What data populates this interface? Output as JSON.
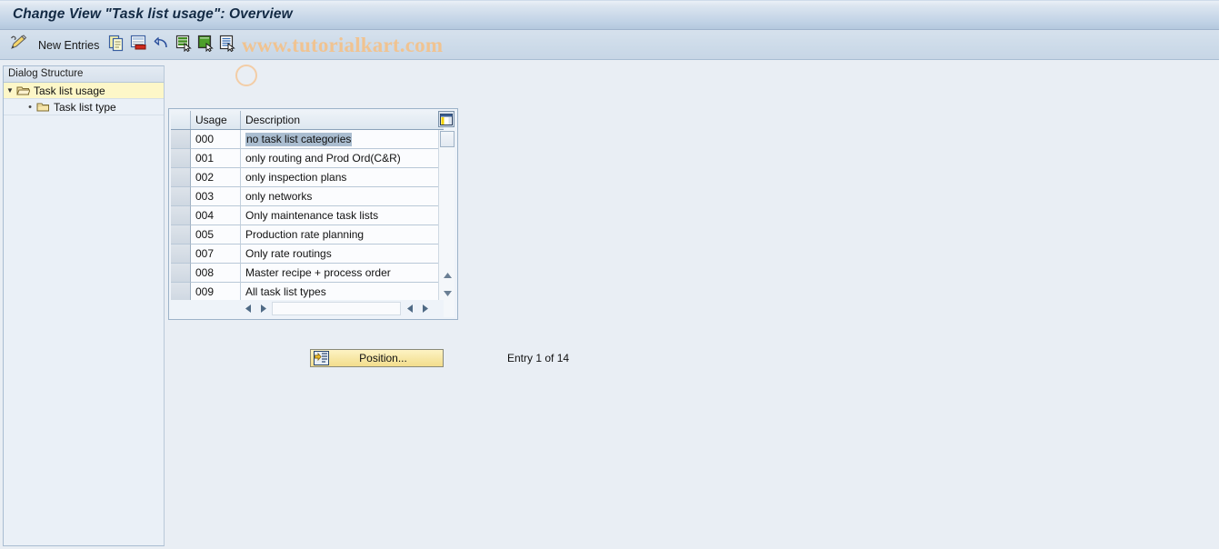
{
  "window": {
    "title": "Change View \"Task list usage\": Overview"
  },
  "toolbar": {
    "new_entries_label": "New Entries",
    "icons": [
      {
        "name": "pencil-icon",
        "title": "Display/Change"
      },
      {
        "name": "copy-icon",
        "title": "Copy As..."
      },
      {
        "name": "delete-row-icon",
        "title": "Delete"
      },
      {
        "name": "undo-icon",
        "title": "Undo Change"
      },
      {
        "name": "select-all-icon",
        "title": "Select All"
      },
      {
        "name": "deselect-all-icon",
        "title": "Deselect All"
      },
      {
        "name": "details-icon",
        "title": "Details"
      }
    ],
    "watermark": "www.tutorialkart.com"
  },
  "sidebar": {
    "header": "Dialog Structure",
    "items": [
      {
        "label": "Task list usage",
        "level": 0,
        "selected": true,
        "expanded": true,
        "icon": "open-folder-icon"
      },
      {
        "label": "Task list type",
        "level": 1,
        "selected": false,
        "expanded": false,
        "icon": "folder-icon"
      }
    ]
  },
  "table": {
    "columns": [
      "Usage",
      "Description"
    ],
    "rows": [
      {
        "usage": "000",
        "description": "no task list categories",
        "selected": true
      },
      {
        "usage": "001",
        "description": "only routing and Prod Ord(C&R)",
        "selected": false
      },
      {
        "usage": "002",
        "description": "only inspection plans",
        "selected": false
      },
      {
        "usage": "003",
        "description": "only networks",
        "selected": false
      },
      {
        "usage": "004",
        "description": "Only maintenance task lists",
        "selected": false
      },
      {
        "usage": "005",
        "description": "Production rate planning",
        "selected": false
      },
      {
        "usage": "007",
        "description": "Only rate routings",
        "selected": false
      },
      {
        "usage": "008",
        "description": "Master recipe + process order",
        "selected": false
      },
      {
        "usage": "009",
        "description": "All task list types",
        "selected": false
      }
    ],
    "config_icon": "table-settings-icon",
    "scroll": {
      "left_arrow": "◄",
      "right_arrow": "►",
      "up_arrow": "▲",
      "down_arrow": "▼"
    }
  },
  "footer": {
    "position_button_label": "Position...",
    "entry_counter": "Entry 1 of 14"
  },
  "colors": {
    "title_accent": "#b4c8de",
    "selected_tree": "#fdf7c8",
    "selected_text": "#aabdd0",
    "button_yellow": "#f7e7a4",
    "watermark": "#f0c391"
  }
}
